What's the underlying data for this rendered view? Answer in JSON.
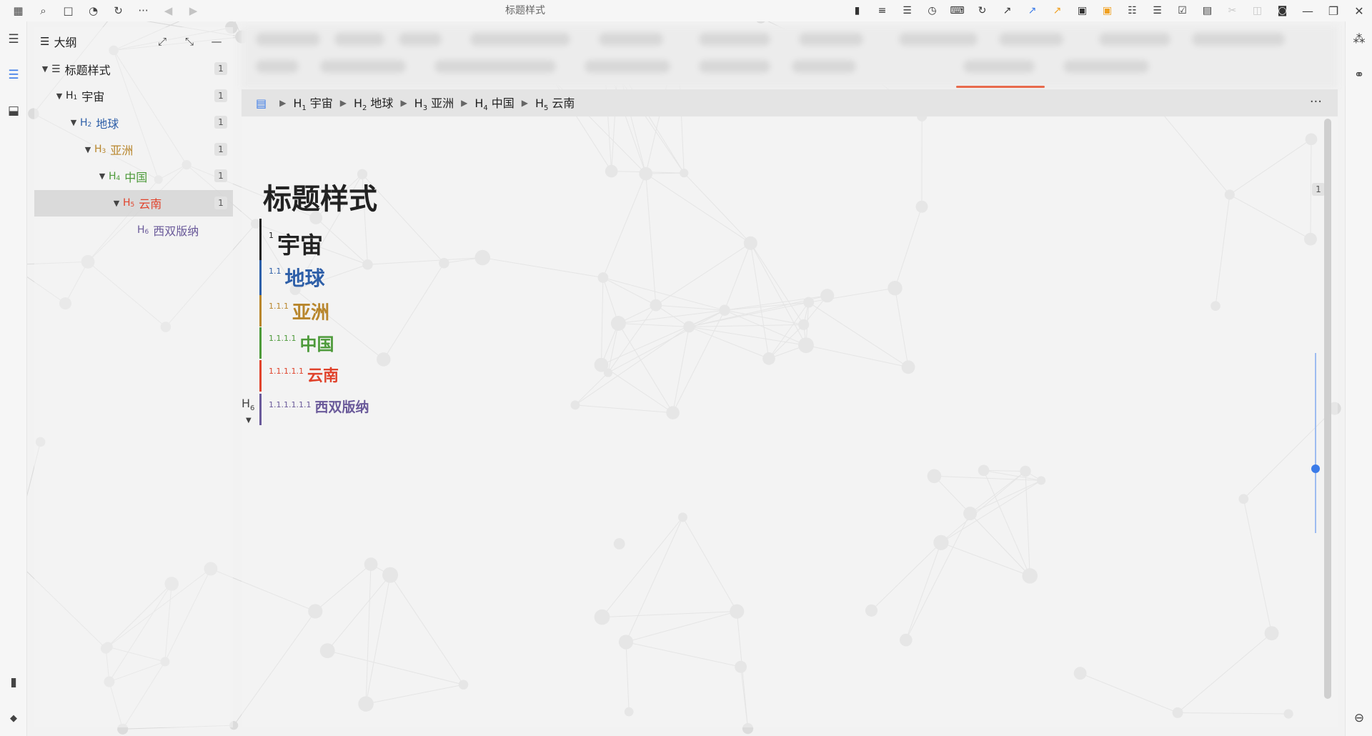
{
  "window": {
    "title": "标题样式"
  },
  "topbar": {
    "left_icons": [
      "calendar-icon",
      "search-icon",
      "square-icon",
      "history-icon",
      "refresh-icon",
      "more-icon",
      "back-icon",
      "forward-icon"
    ],
    "left_glyphs": [
      "▦",
      "⌕",
      "□",
      "◔",
      "↻",
      "···",
      "◀",
      "▶"
    ],
    "right_icons": [
      "bookmark-icon",
      "list-icon",
      "outdent-icon",
      "clock-icon",
      "keyboard-icon",
      "refresh-icon",
      "arrow-ne-icon",
      "arrow-ne-blue-icon",
      "arrow-ne-orange-icon",
      "image-icon",
      "image-orange-icon",
      "bullet-list-icon",
      "number-list-icon",
      "checkbox-icon",
      "copy-icon",
      "scissors-icon",
      "cup-icon",
      "box-icon"
    ],
    "right_glyphs": [
      "▮",
      "≡",
      "☰",
      "◷",
      "⌨",
      "↻",
      "↗",
      "↗",
      "↗",
      "▣",
      "▣",
      "☷",
      "☰",
      "☑",
      "▤",
      "✂",
      "◫",
      "◙"
    ],
    "window_controls": {
      "minimize": "—",
      "restore": "❐",
      "close": "✕"
    }
  },
  "dock": {
    "left_top": [
      {
        "name": "menu-icon",
        "glyph": "☰"
      },
      {
        "name": "outline-icon",
        "glyph": "☰"
      },
      {
        "name": "inbox-icon",
        "glyph": "⬓"
      }
    ],
    "left_bottom": [
      {
        "name": "bookmark-icon",
        "glyph": "▮"
      },
      {
        "name": "tag-icon",
        "glyph": "◆"
      }
    ],
    "right_top": [
      {
        "name": "graph-icon",
        "glyph": "⁂"
      },
      {
        "name": "global-graph-icon",
        "glyph": "⚭"
      }
    ],
    "right_bottom": [
      {
        "name": "backlink-icon",
        "glyph": "⊖"
      }
    ]
  },
  "outline": {
    "title": "大纲",
    "expand_label": "⤢",
    "collapse_label": "⤡",
    "minimize_label": "—",
    "items": [
      {
        "level": 0,
        "tag": "",
        "label": "标题样式",
        "count": "1",
        "color": "#222222",
        "expanded": true
      },
      {
        "level": 1,
        "tag": "H",
        "sub": "1",
        "label": "宇宙",
        "count": "1",
        "color": "#222222",
        "expanded": true
      },
      {
        "level": 2,
        "tag": "H",
        "sub": "2",
        "label": "地球",
        "count": "1",
        "color": "#2e5fa8",
        "expanded": true
      },
      {
        "level": 3,
        "tag": "H",
        "sub": "3",
        "label": "亚洲",
        "count": "1",
        "color": "#b8862c",
        "expanded": true
      },
      {
        "level": 4,
        "tag": "H",
        "sub": "4",
        "label": "中国",
        "count": "1",
        "color": "#4d9a3a",
        "expanded": true
      },
      {
        "level": 5,
        "tag": "H",
        "sub": "5",
        "label": "云南",
        "count": "1",
        "color": "#e0432c",
        "expanded": true,
        "selected": true
      },
      {
        "level": 6,
        "tag": "H",
        "sub": "6",
        "label": "西双版纳",
        "count": "",
        "color": "#6a5a9a",
        "expanded": false
      }
    ]
  },
  "breadcrumb": {
    "items": [
      {
        "tag": "H",
        "sub": "1",
        "label": "宇宙"
      },
      {
        "tag": "H",
        "sub": "2",
        "label": "地球"
      },
      {
        "tag": "H",
        "sub": "3",
        "label": "亚洲"
      },
      {
        "tag": "H",
        "sub": "4",
        "label": "中国"
      },
      {
        "tag": "H",
        "sub": "5",
        "label": "云南"
      }
    ],
    "more": "···"
  },
  "document": {
    "title": "标题样式",
    "badge": "1",
    "headings": [
      {
        "num": "1",
        "text": "宇宙",
        "color": "#222222"
      },
      {
        "num": "1.1",
        "text": "地球",
        "color": "#2e5fa8"
      },
      {
        "num": "1.1.1",
        "text": "亚洲",
        "color": "#b8862c"
      },
      {
        "num": "1.1.1.1",
        "text": "中国",
        "color": "#4d9a3a"
      },
      {
        "num": "1.1.1.1.1",
        "text": "云南",
        "color": "#e0432c"
      },
      {
        "num": "1.1.1.1.1.1",
        "text": "西双版纳",
        "color": "#6a5a9a"
      }
    ],
    "h6_gutter": {
      "tag": "H",
      "sub": "6",
      "arrow": "▼"
    }
  }
}
